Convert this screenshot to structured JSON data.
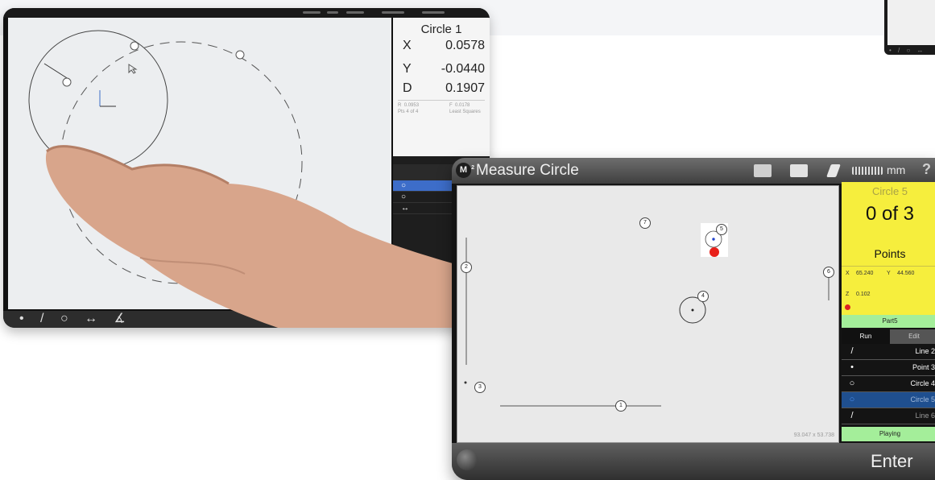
{
  "photo_screen": {
    "panel": {
      "title": "Circle 1",
      "rows": [
        {
          "label": "X",
          "value": "0.0578"
        },
        {
          "label": "Y",
          "value": "-0.0440"
        },
        {
          "label": "D",
          "value": "0.1907"
        }
      ],
      "small_left_1": "R",
      "small_left_val": "0.0953",
      "small_left_2": "Pts 4 of 4",
      "small_right_1": "F",
      "small_right_val": "0.0178",
      "small_right_2": "Least Squares"
    },
    "list_icons": [
      "○",
      "○",
      "↔"
    ],
    "toolbar_icons": "• / ○ ↔ ∡"
  },
  "app": {
    "title": "Measure Circle",
    "unit": "mm",
    "help": "?",
    "canvas_size": "93.047 x 53.738",
    "point_numbers": [
      "1",
      "2",
      "3",
      "4",
      "5",
      "6",
      "7"
    ],
    "info": {
      "feature": "Circle 5",
      "count": "0 of 3",
      "label": "Points",
      "x_label": "X",
      "x_value": "65.240",
      "y_label": "Y",
      "y_value": "44.560",
      "z_label": "Z",
      "z_value": "0.102"
    },
    "part": "Part5",
    "tabs": {
      "run": "Run",
      "edit": "Edit"
    },
    "steps": [
      {
        "icon": "/",
        "label": "Line 2"
      },
      {
        "icon": "•",
        "label": "Point 3"
      },
      {
        "icon": "○",
        "label": "Circle 4"
      },
      {
        "icon": "○",
        "label": "Circle 5"
      },
      {
        "icon": "/",
        "label": "Line 6"
      }
    ],
    "status": "Playing",
    "enter": "Enter"
  },
  "colors": {
    "accent_yellow": "#f6ee3d",
    "status_green": "#a4ee9a",
    "selection_blue": "#3d6dc9",
    "point_red": "#e8201a"
  }
}
